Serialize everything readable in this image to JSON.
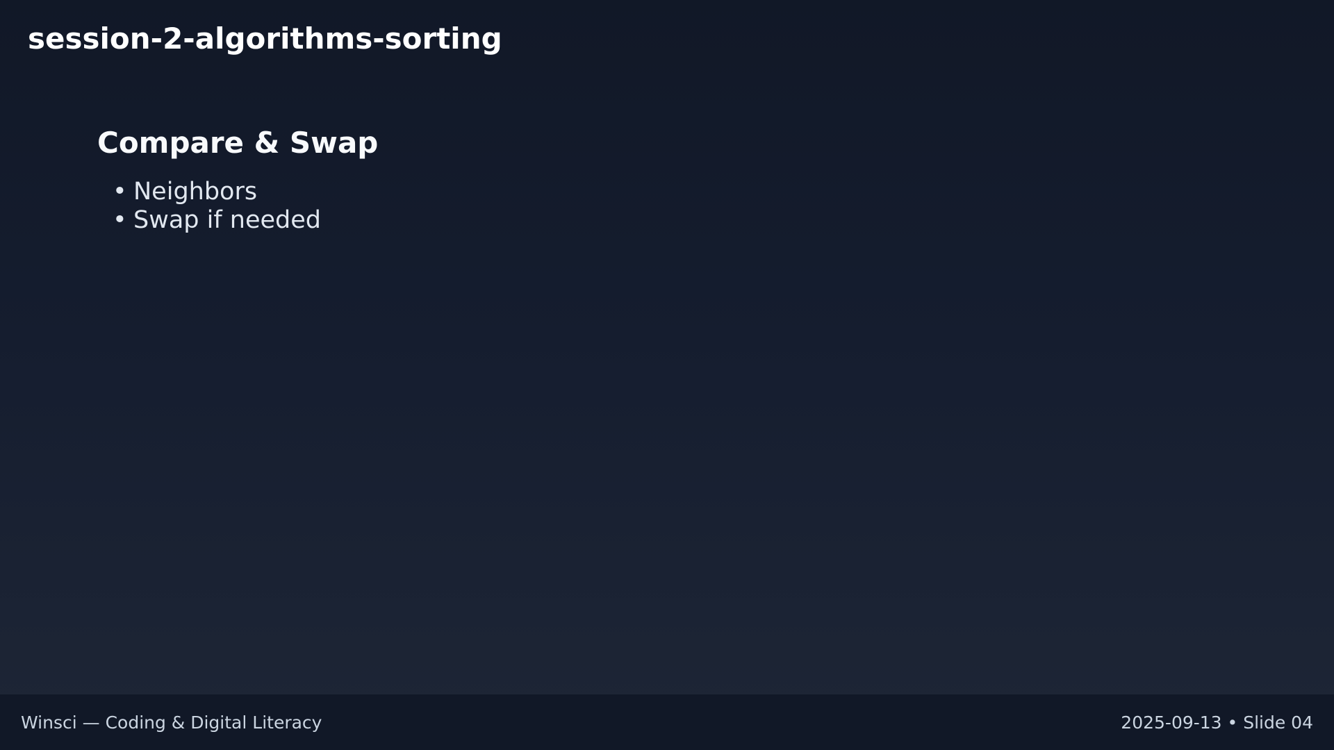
{
  "deck": {
    "title": "session-2-algorithms-sorting"
  },
  "slide": {
    "heading": "Compare & Swap",
    "bullet_marker": "•",
    "bullets": [
      "Neighbors",
      "Swap if needed"
    ]
  },
  "footer": {
    "left": "Winsci — Coding & Digital Literacy",
    "right": "2025-09-13 • Slide 04"
  },
  "colors": {
    "background_top": "#111827",
    "background_bottom": "#1e2636",
    "footer_background": "#111827",
    "title_text": "#ffffff",
    "body_text": "#e2e8f0",
    "footer_text": "#cbd5e1"
  }
}
